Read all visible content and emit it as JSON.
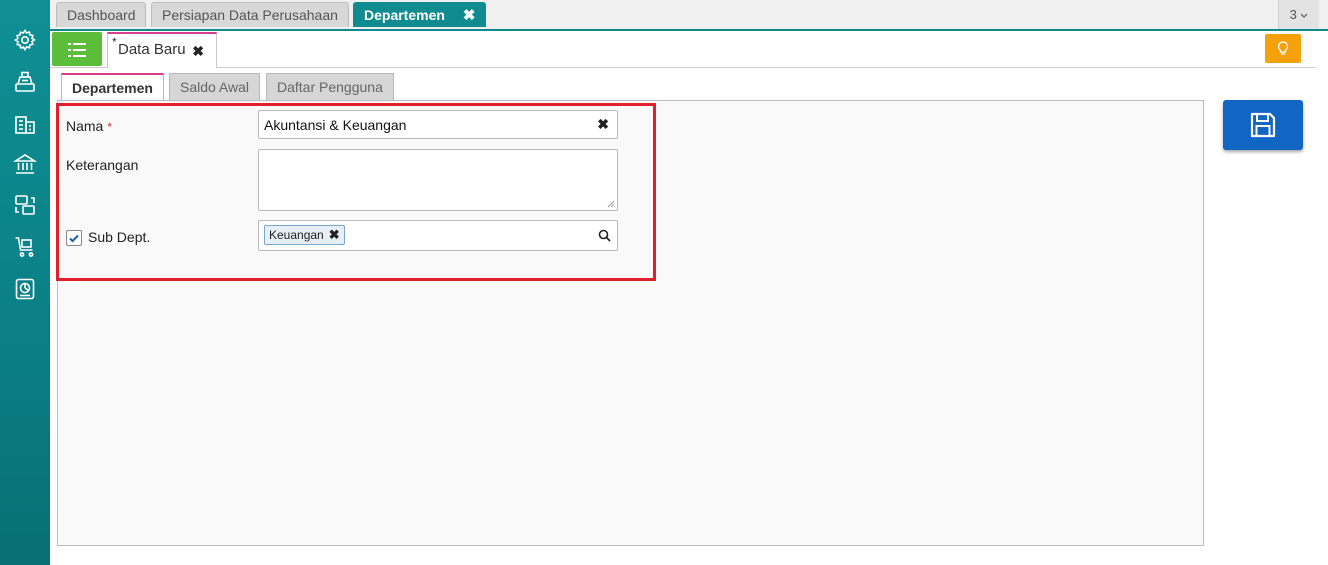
{
  "sidebar": {
    "icons": [
      "settings-icon",
      "cash-register-icon",
      "buildings-icon",
      "bank-icon",
      "transfer-icon",
      "cart-icon",
      "report-chart-icon"
    ]
  },
  "top_tabs": [
    {
      "label": "Dashboard",
      "active": false
    },
    {
      "label": "Persiapan Data Perusahaan",
      "active": false
    },
    {
      "label": "Departemen",
      "active": true,
      "close": "✖"
    }
  ],
  "tab_counter": "3",
  "doc_tab": {
    "modified_mark": "*",
    "label": "Data Baru",
    "close": "✖"
  },
  "form_tabs": [
    {
      "label": "Departemen",
      "active": true
    },
    {
      "label": "Saldo Awal",
      "active": false
    },
    {
      "label": "Daftar Pengguna",
      "active": false
    }
  ],
  "form": {
    "nama_label": "Nama",
    "required_mark": "*",
    "nama_value": "Akuntansi & Keuangan",
    "keterangan_label": "Keterangan",
    "keterangan_value": "",
    "subdept_label": "Sub Dept.",
    "subdept_checked": true,
    "subdept_chip": "Keuangan"
  },
  "colors": {
    "sidebar": "#0f8f94",
    "active_tab": "#108c90",
    "menu_button": "#5bbd3a",
    "hint_button": "#f5a10a",
    "save_button": "#1166c4",
    "highlight": "#e0202d",
    "tab_accent": "#d43f8d"
  }
}
